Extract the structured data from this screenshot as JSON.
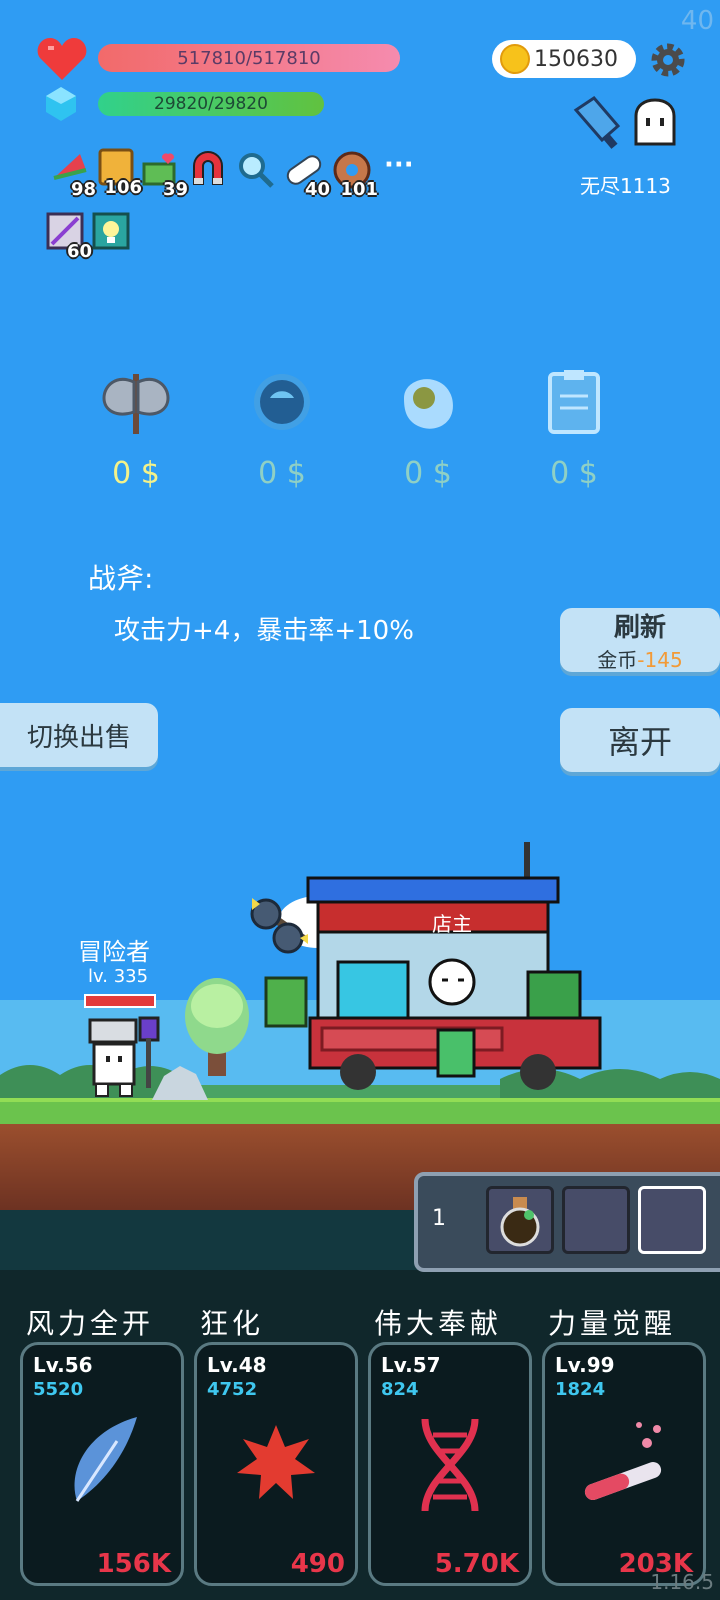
{
  "fps": "40",
  "status": {
    "hp": "517810/517810",
    "mp": "29820/29820",
    "coins": "150630",
    "endless_label": "无尽1113"
  },
  "items": [
    {
      "name": "watermelon-icon",
      "count": "98"
    },
    {
      "name": "book-icon",
      "count": "106"
    },
    {
      "name": "heart-cash-icon",
      "count": "39"
    },
    {
      "name": "magnet-icon",
      "count": ""
    },
    {
      "name": "magnifier-icon",
      "count": ""
    },
    {
      "name": "pill-icon",
      "count": "40"
    },
    {
      "name": "donut-icon",
      "count": "101"
    }
  ],
  "more_label": "···",
  "items2": [
    {
      "name": "scroll-icon",
      "count": "60"
    },
    {
      "name": "lamp-icon",
      "count": ""
    }
  ],
  "shop": {
    "slots": [
      {
        "icon": "battle-axe-icon",
        "price": "0 $",
        "color": "#f3f28a"
      },
      {
        "icon": "blue-orb-icon",
        "price": "0 $",
        "color": "#8fd0c5"
      },
      {
        "icon": "egg-icon",
        "price": "0 $",
        "color": "#8fd0c5"
      },
      {
        "icon": "clipboard-icon",
        "price": "0 $",
        "color": "#8fd0c5"
      }
    ],
    "selected_title": "战斧:",
    "selected_desc": "攻击力+4，暴击率+10%",
    "refresh_label": "刷新",
    "refresh_cost_label": "金币",
    "refresh_cost": "-145",
    "leave_label": "离开",
    "switch_label": "切换出售",
    "shopkeeper_label": "店主"
  },
  "adventurer": {
    "name": "冒险者",
    "level": "lv. 335"
  },
  "inventory": {
    "count": "1"
  },
  "skills": [
    {
      "name": "风力全开",
      "lv": "Lv.56",
      "value": "5520",
      "cost": "156K",
      "icon": "feather-icon"
    },
    {
      "name": "狂化",
      "lv": "Lv.48",
      "value": "4752",
      "cost": "490",
      "icon": "red-splat-icon"
    },
    {
      "name": "伟大奉献",
      "lv": "Lv.57",
      "value": "824",
      "cost": "5.70K",
      "icon": "dna-icon"
    },
    {
      "name": "力量觉醒",
      "lv": "Lv.99",
      "value": "1824",
      "cost": "203K",
      "icon": "test-tube-icon"
    }
  ],
  "version": "1.16.5"
}
